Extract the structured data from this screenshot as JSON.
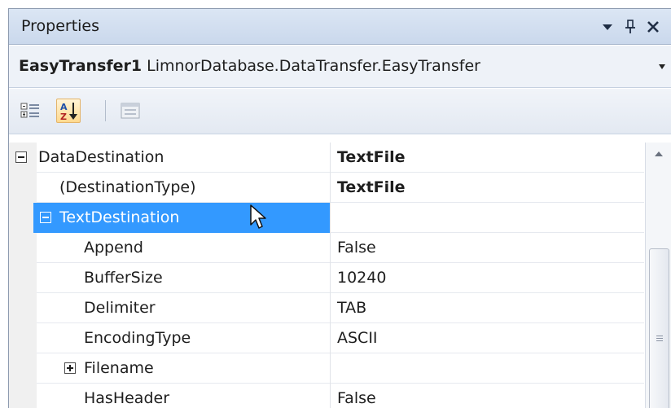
{
  "window": {
    "title": "Properties"
  },
  "title_buttons": [
    "dropdown-arrow",
    "pin",
    "close"
  ],
  "selector": {
    "object_name": "EasyTransfer1",
    "object_type": "LimnorDatabase.DataTransfer.EasyTransfer"
  },
  "toolbar": {
    "categorized_icon": "categorized-icon",
    "alphabetical_icon": "alphabetical-icon",
    "property_pages_icon": "property-pages-icon"
  },
  "grid": {
    "rows": [
      {
        "name": "DataDestination",
        "value": "TextFile",
        "bold_value": true,
        "toggle": "collapse",
        "level": 0,
        "selected": false
      },
      {
        "name": "(DestinationType)",
        "value": "TextFile",
        "bold_value": true,
        "toggle": null,
        "level": 1,
        "selected": false
      },
      {
        "name": "TextDestination",
        "value": "",
        "bold_value": false,
        "toggle": "collapse",
        "level": 1,
        "selected": true
      },
      {
        "name": "Append",
        "value": "False",
        "bold_value": false,
        "toggle": null,
        "level": 2,
        "selected": false
      },
      {
        "name": "BufferSize",
        "value": "10240",
        "bold_value": false,
        "toggle": null,
        "level": 2,
        "selected": false
      },
      {
        "name": "Delimiter",
        "value": "TAB",
        "bold_value": false,
        "toggle": null,
        "level": 2,
        "selected": false
      },
      {
        "name": "EncodingType",
        "value": "ASCII",
        "bold_value": false,
        "toggle": null,
        "level": 2,
        "selected": false
      },
      {
        "name": "Filename",
        "value": "",
        "bold_value": false,
        "toggle": "expand",
        "level": 2,
        "selected": false
      },
      {
        "name": "HasHeader",
        "value": "False",
        "bold_value": false,
        "toggle": null,
        "level": 2,
        "selected": false
      }
    ]
  },
  "colors": {
    "selection": "#3399ff",
    "title_bar": "#cad8ec"
  }
}
